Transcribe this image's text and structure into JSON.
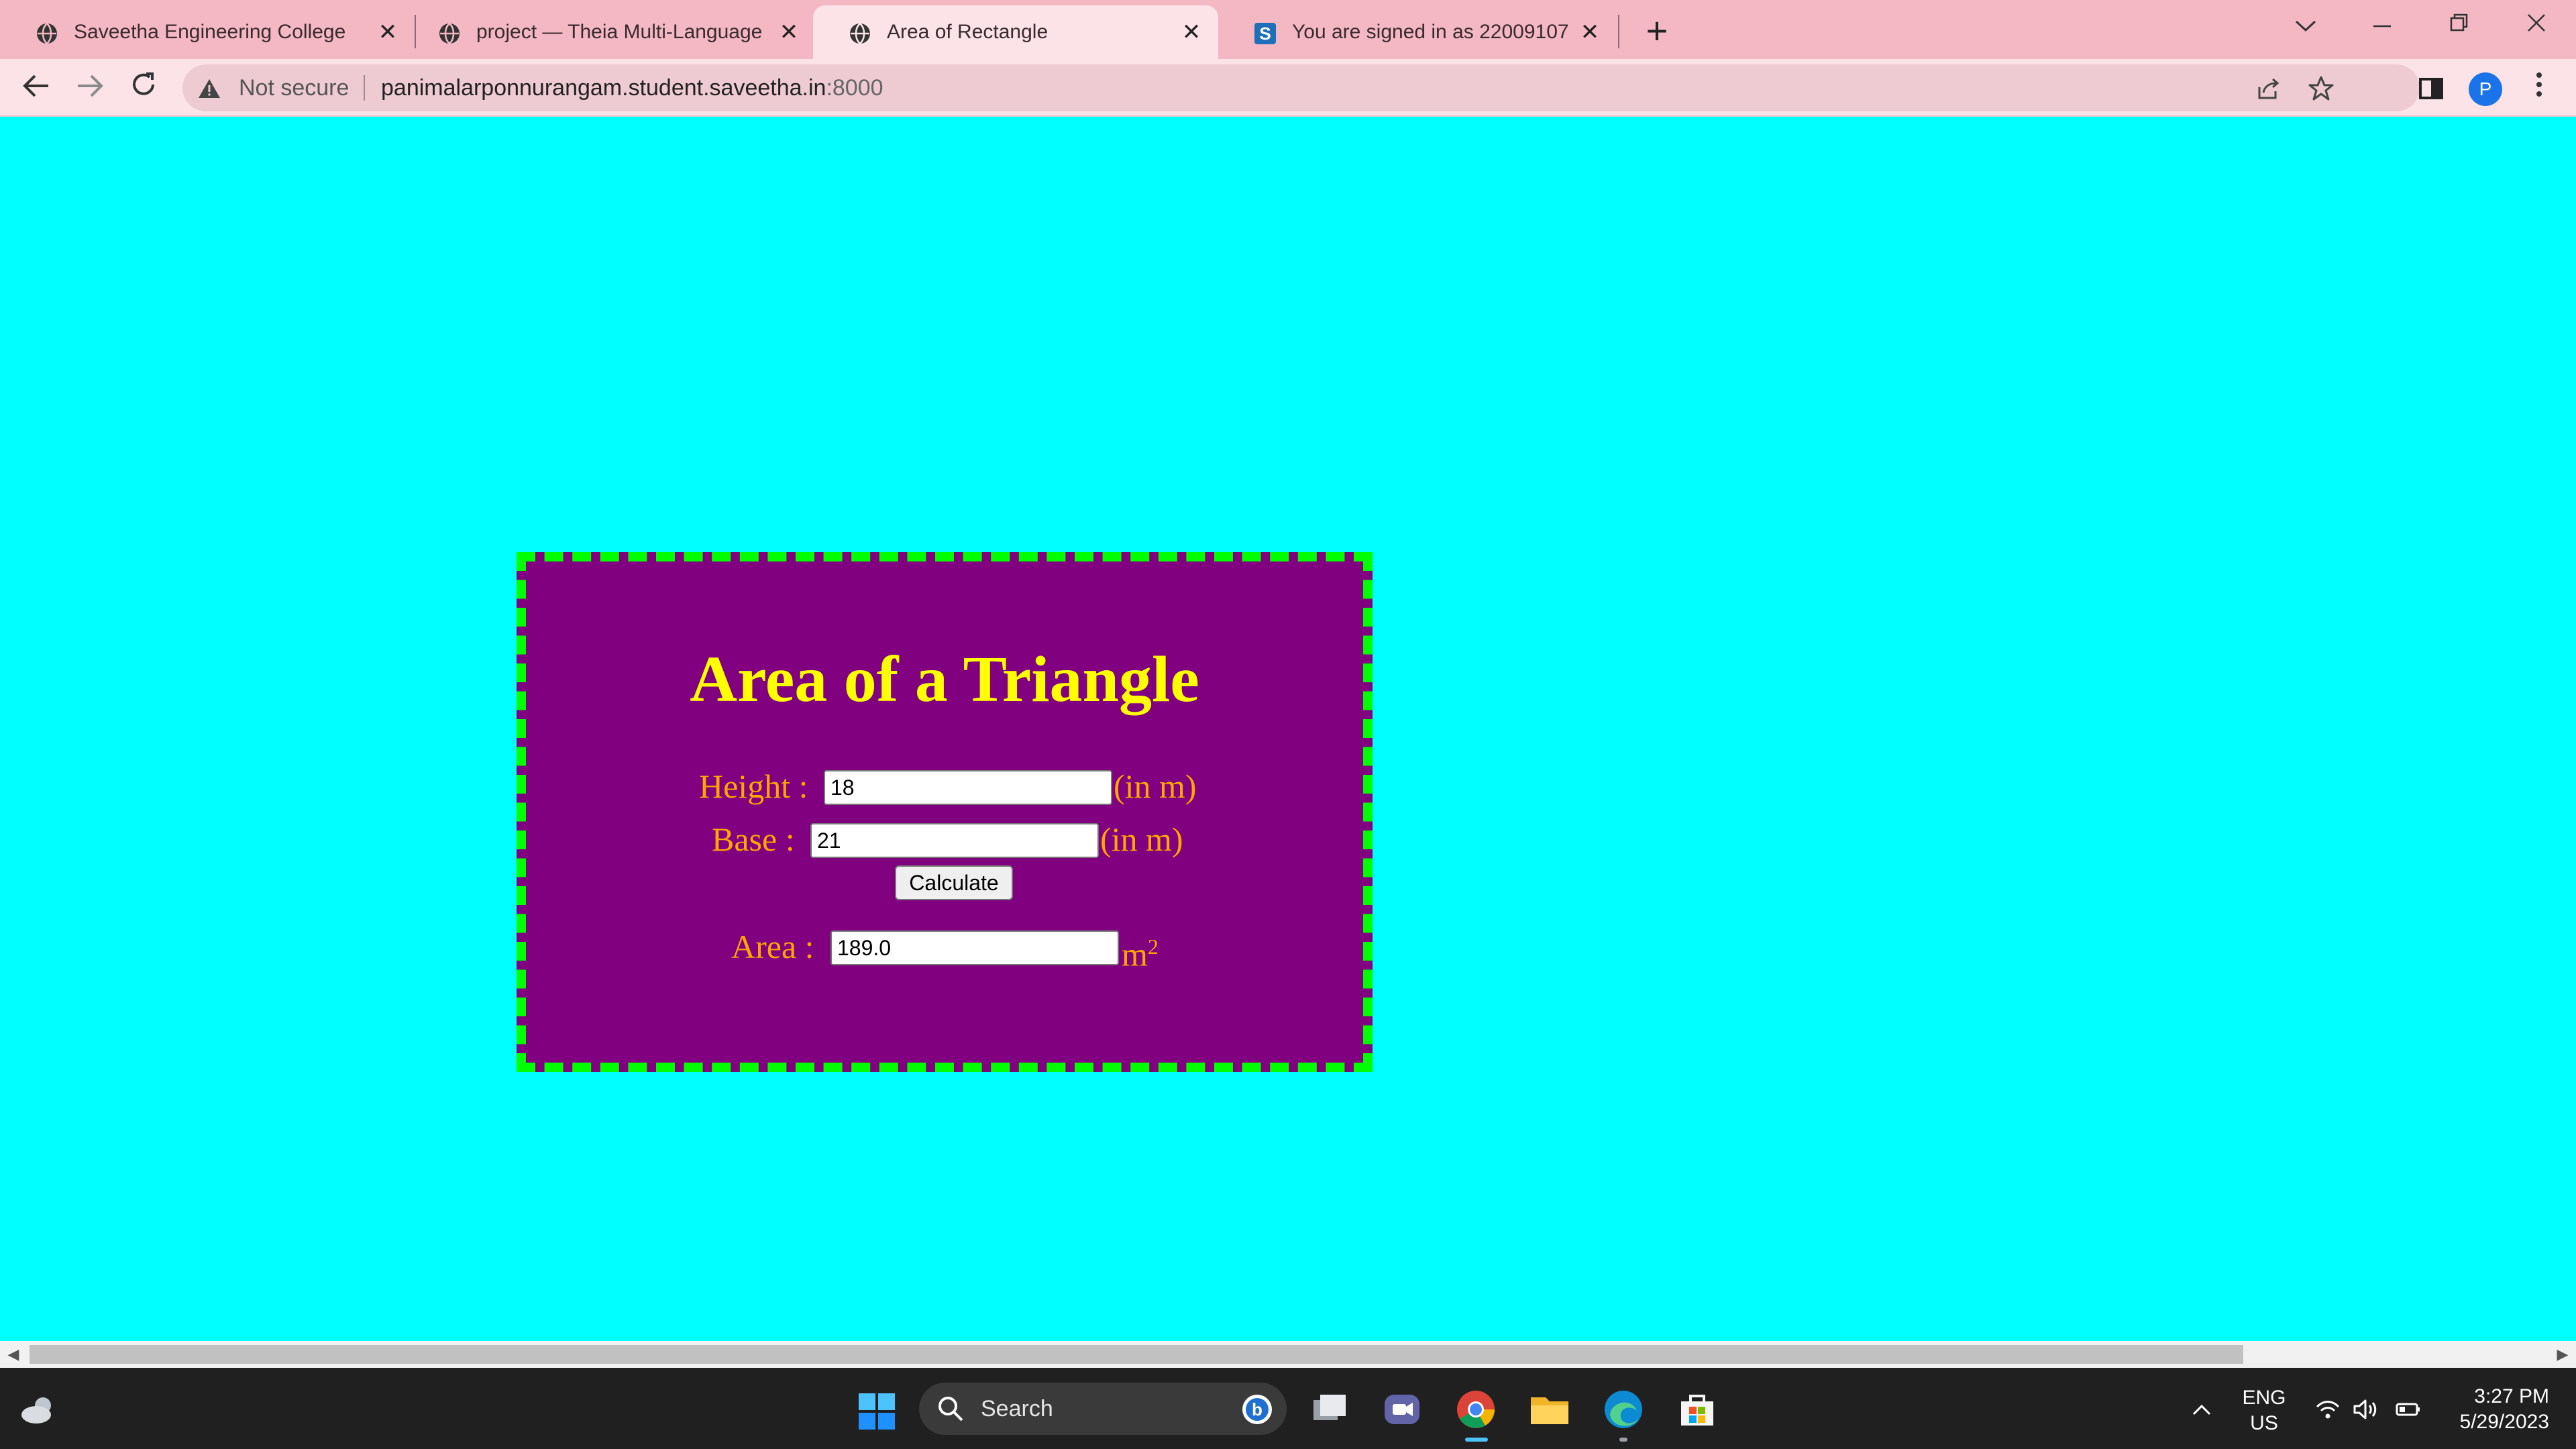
{
  "browser": {
    "tabs": [
      {
        "label": "Saveetha Engineering College",
        "icon": "globe-icon",
        "active": false
      },
      {
        "label": "project — Theia Multi-Language",
        "icon": "globe-icon",
        "active": false
      },
      {
        "label": "Area of Rectangle",
        "icon": "globe-icon",
        "active": true
      },
      {
        "label": "You are signed in as 22009107",
        "icon": "s-logo-icon",
        "active": false
      }
    ],
    "new_tab_label": "+",
    "close_glyph": "✕",
    "security_label": "Not secure",
    "url_host": "panimalarponnurangam.student.saveetha.in",
    "url_port": ":8000",
    "profile_initial": "P",
    "accent_color": "#1a73e8"
  },
  "page": {
    "background_color": "#00ffff",
    "box_color": "#800080",
    "border_color": "#00ff00",
    "title": "Area of a Triangle",
    "height_label": "Height :",
    "height_value": "18",
    "base_label": "Base :",
    "base_value": "21",
    "unit_label": "(in m)",
    "calculate_label": "Calculate",
    "area_label": "Area :",
    "area_value": "189.0",
    "area_unit": "m",
    "area_unit_exp": "2"
  },
  "taskbar": {
    "search_placeholder": "Search",
    "lang_line1": "ENG",
    "lang_line2": "US",
    "time": "3:27 PM",
    "date": "5/29/2023",
    "apps": [
      "windows-start-icon",
      "bing-icon",
      "task-view-icon",
      "teams-chat-icon",
      "chrome-icon",
      "file-explorer-icon",
      "edge-icon",
      "microsoft-store-icon"
    ]
  }
}
